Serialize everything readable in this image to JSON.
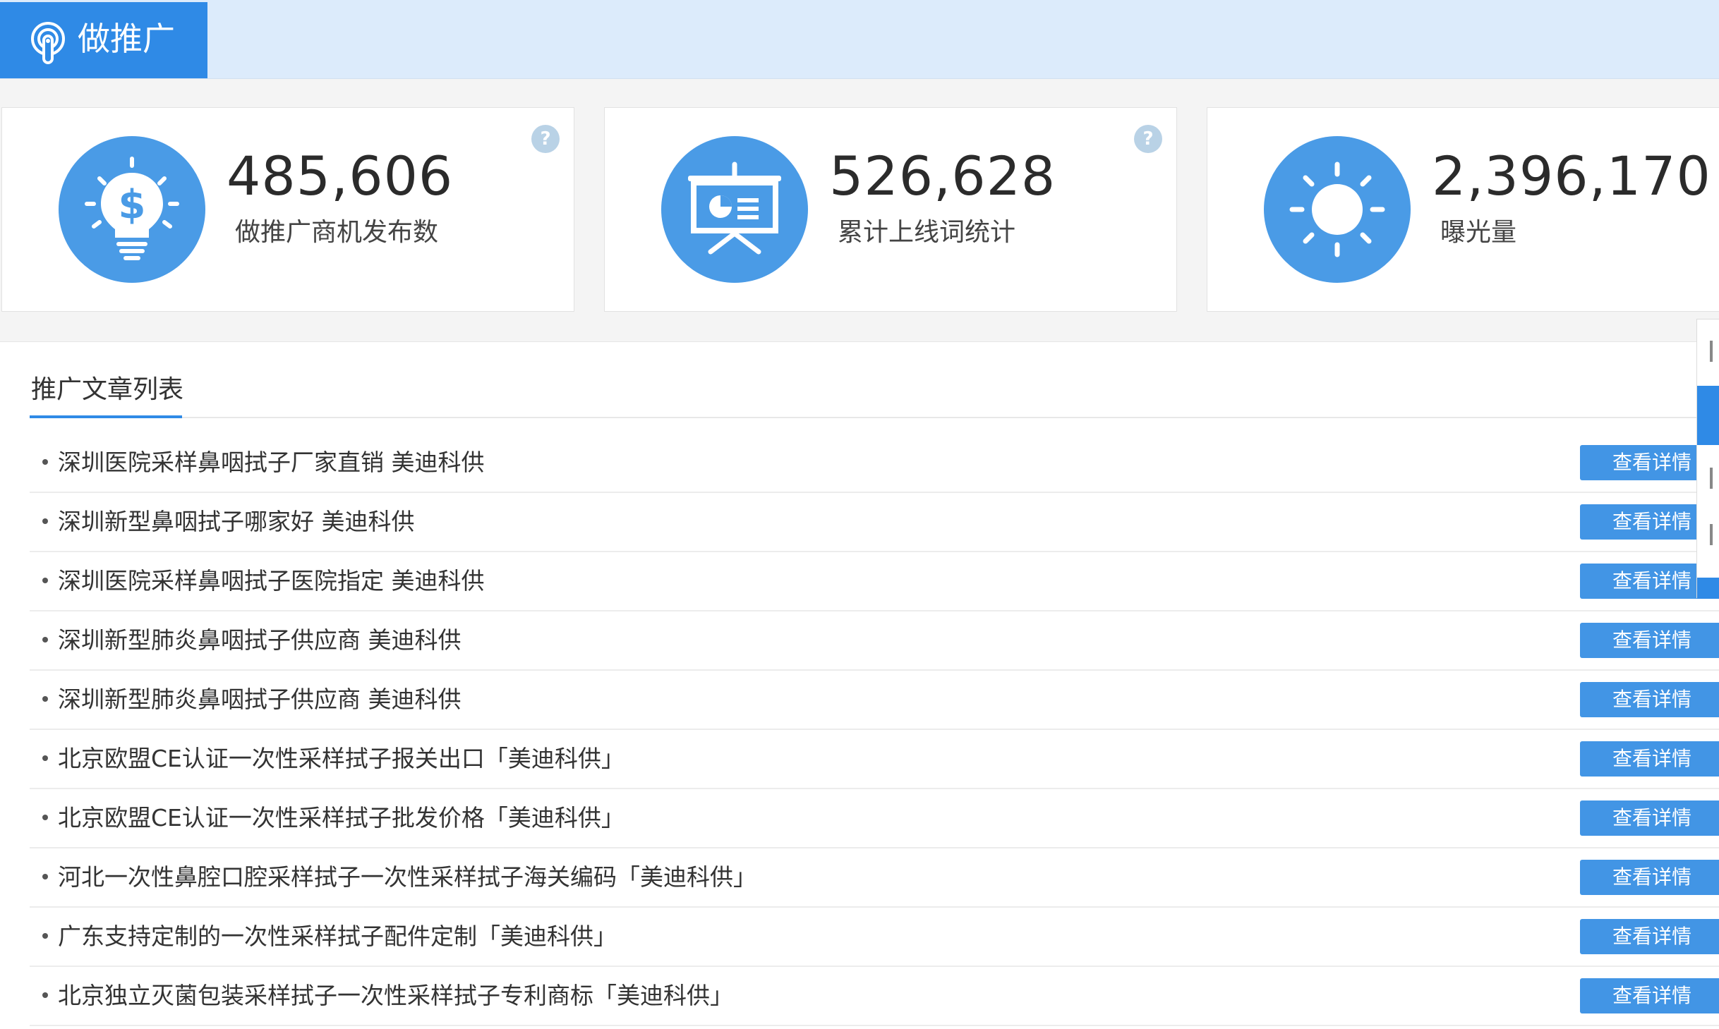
{
  "header": {
    "title": "做推广",
    "icon": "broadcast-icon"
  },
  "stats": [
    {
      "value": "485,606",
      "label": "做推广商机发布数",
      "icon": "idea-dollar-icon",
      "help": "?"
    },
    {
      "value": "526,628",
      "label": "累计上线词统计",
      "icon": "presentation-board-icon",
      "help": "?"
    },
    {
      "value": "2,396,170",
      "label": "曝光量",
      "icon": "sun-icon"
    }
  ],
  "articles": {
    "tab_title": "推广文章列表",
    "detail_label": "查看详情",
    "items": [
      "深圳医院采样鼻咽拭子厂家直销 美迪科供",
      "深圳新型鼻咽拭子哪家好 美迪科供",
      "深圳医院采样鼻咽拭子医院指定 美迪科供",
      "深圳新型肺炎鼻咽拭子供应商 美迪科供",
      "深圳新型肺炎鼻咽拭子供应商 美迪科供",
      "北京欧盟CE认证一次性采样拭子报关出口「美迪科供」",
      "北京欧盟CE认证一次性采样拭子批发价格「美迪科供」",
      "河北一次性鼻腔口腔采样拭子一次性采样拭子海关编码「美迪科供」",
      "广东支持定制的一次性采样拭子配件定制「美迪科供」",
      "北京独立灭菌包装采样拭子一次性采样拭子专利商标「美迪科供」"
    ]
  },
  "colors": {
    "accent": "#2f8ae6",
    "header_bg": "#dcebfb",
    "icon_circle": "#4a9be6",
    "button": "#4295e5"
  }
}
